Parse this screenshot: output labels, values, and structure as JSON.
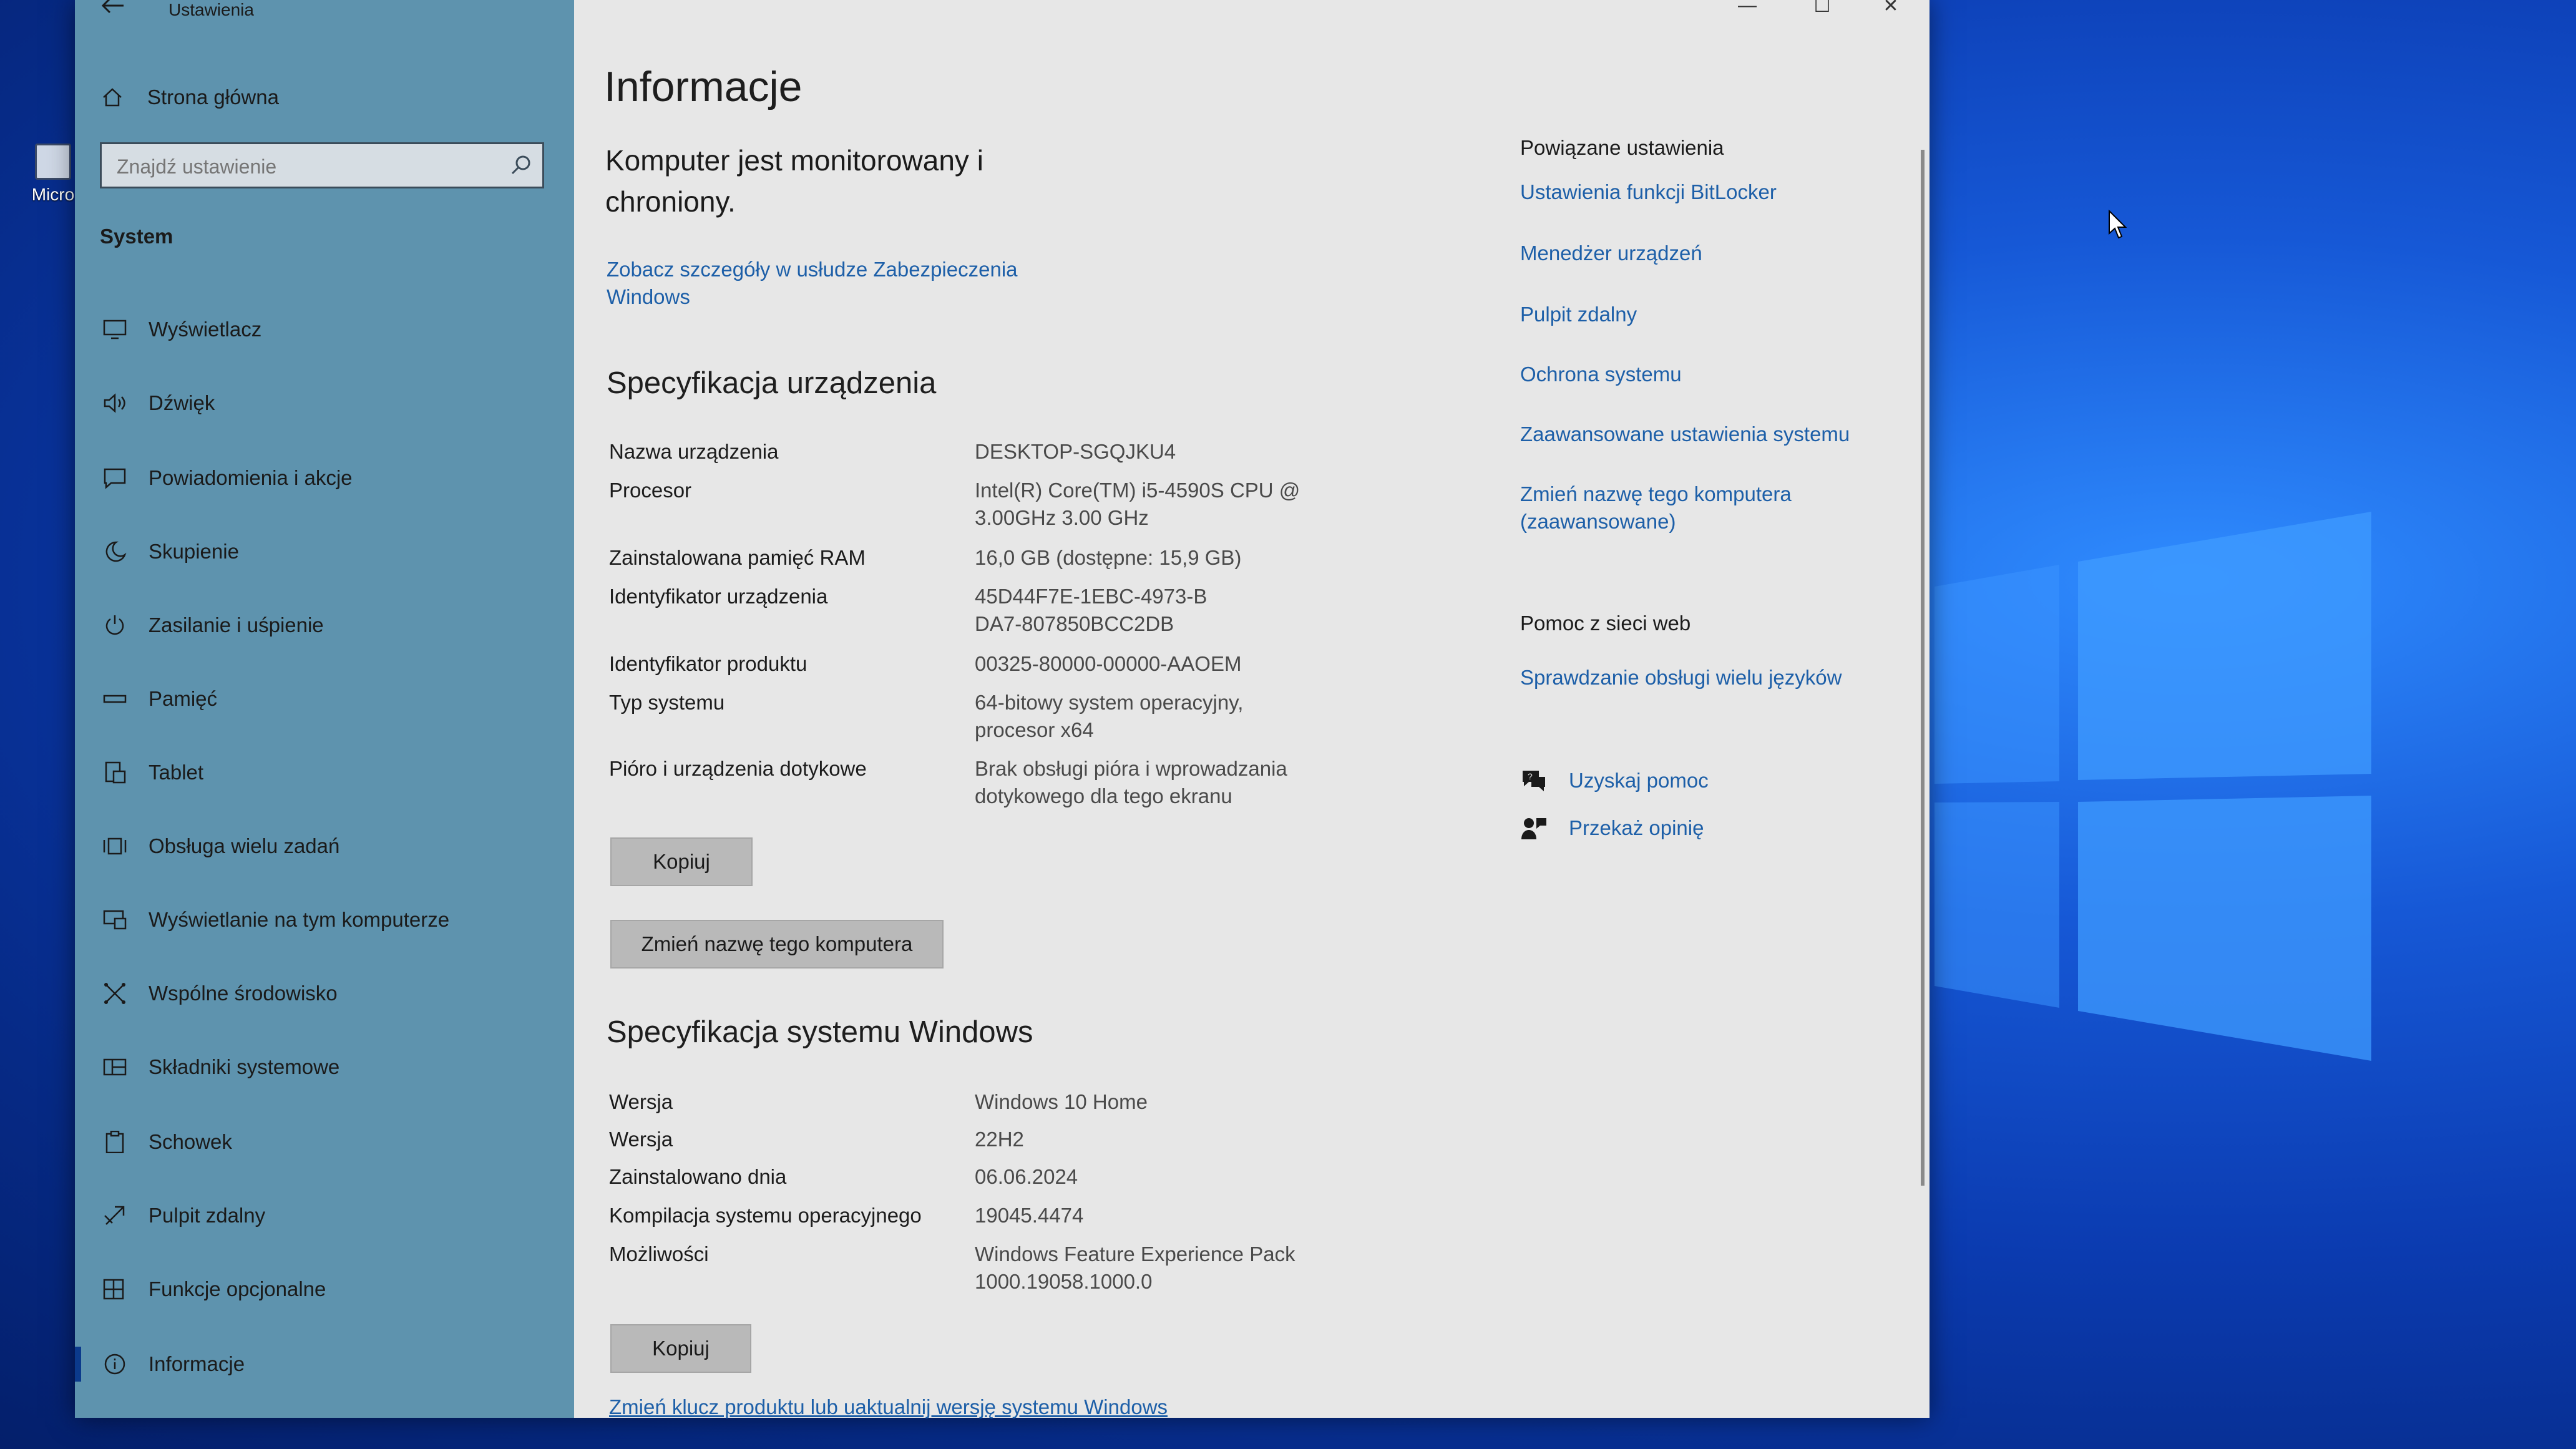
{
  "window": {
    "title": "Ustawienia"
  },
  "sidebar": {
    "home_label": "Strona główna",
    "search_placeholder": "Znajdź ustawienie",
    "section_label": "System",
    "items": [
      {
        "label": "Wyświetlacz",
        "icon": "monitor-icon"
      },
      {
        "label": "Dźwięk",
        "icon": "speaker-icon"
      },
      {
        "label": "Powiadomienia i akcje",
        "icon": "notification-icon"
      },
      {
        "label": "Skupienie",
        "icon": "moon-icon"
      },
      {
        "label": "Zasilanie i uśpienie",
        "icon": "power-icon"
      },
      {
        "label": "Pamięć",
        "icon": "storage-icon"
      },
      {
        "label": "Tablet",
        "icon": "tablet-icon"
      },
      {
        "label": "Obsługa wielu zadań",
        "icon": "multitasking-icon"
      },
      {
        "label": "Wyświetlanie na tym komputerze",
        "icon": "projecting-icon"
      },
      {
        "label": "Wspólne środowisko",
        "icon": "shared-experiences-icon"
      },
      {
        "label": "Składniki systemowe",
        "icon": "system-components-icon"
      },
      {
        "label": "Schowek",
        "icon": "clipboard-icon"
      },
      {
        "label": "Pulpit zdalny",
        "icon": "remote-desktop-icon"
      },
      {
        "label": "Funkcje opcjonalne",
        "icon": "optional-features-icon"
      },
      {
        "label": "Informacje",
        "icon": "info-icon",
        "active": true
      }
    ]
  },
  "main": {
    "title": "Informacje",
    "monitor_text": "Komputer jest monitorowany i chroniony.",
    "security_link": "Zobacz szczegóły w usłudze Zabezpieczenia Windows",
    "device_spec": {
      "heading": "Specyfikacja urządzenia",
      "rows": [
        {
          "key": "Nazwa urządzenia",
          "value": "DESKTOP-SGQJKU4"
        },
        {
          "key": "Procesor",
          "value": "Intel(R) Core(TM) i5-4590S CPU @ 3.00GHz   3.00 GHz"
        },
        {
          "key": "Zainstalowana pamięć RAM",
          "value": "16,0 GB (dostępne: 15,9 GB)"
        },
        {
          "key": "Identyfikator urządzenia",
          "value": "45D44F7E-1EBC-4973-BDA7-807850BCC2DB"
        },
        {
          "key": "Identyfikator produktu",
          "value": "00325-80000-00000-AAOEM"
        },
        {
          "key": "Typ systemu",
          "value": "64-bitowy system operacyjny, procesor x64"
        },
        {
          "key": "Pióro i urządzenia dotykowe",
          "value": "Brak obsługi pióra i wprowadzania dotykowego dla tego ekranu"
        }
      ],
      "copy_button": "Kopiuj",
      "rename_button": "Zmień nazwę tego komputera"
    },
    "windows_spec": {
      "heading": "Specyfikacja systemu Windows",
      "rows": [
        {
          "key": "Wersja",
          "value": "Windows 10 Home"
        },
        {
          "key": "Wersja",
          "value": "22H2"
        },
        {
          "key": "Zainstalowano dnia",
          "value": "06.06.2024"
        },
        {
          "key": "Kompilacja systemu operacyjnego",
          "value": "19045.4474"
        },
        {
          "key": "Możliwości",
          "value": "Windows Feature Experience Pack 1000.19058.1000.0"
        }
      ],
      "copy_button": "Kopiuj"
    },
    "product_key_link": "Zmień klucz produktu lub uaktualnij wersję systemu Windows"
  },
  "related": {
    "heading": "Powiązane ustawienia",
    "links": [
      "Ustawienia funkcji BitLocker",
      "Menedżer urządzeń",
      "Pulpit zdalny",
      "Ochrona systemu",
      "Zaawansowane ustawienia systemu",
      "Zmień nazwę tego komputera (zaawansowane)"
    ],
    "help_heading": "Pomoc z sieci web",
    "help_link": "Sprawdzanie obsługi wielu języków",
    "get_help": "Uzyskaj pomoc",
    "feedback": "Przekaż opinię"
  },
  "desktop": {
    "icon_label": "Micro"
  },
  "colors": {
    "sidebar": "#5e93ae",
    "content": "#e7e7e7",
    "link": "#1d5fa8",
    "desktop": "#1658d6"
  }
}
